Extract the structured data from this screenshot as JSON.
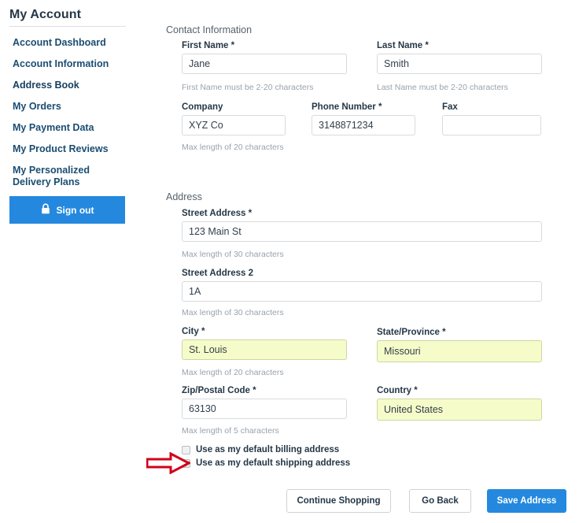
{
  "sidebar": {
    "title": "My Account",
    "items": [
      {
        "label": "Account Dashboard",
        "active": false
      },
      {
        "label": "Account Information",
        "active": false
      },
      {
        "label": "Address Book",
        "active": true
      },
      {
        "label": "My Orders",
        "active": false
      },
      {
        "label": "My Payment Data",
        "active": false
      },
      {
        "label": "My Product Reviews",
        "active": false
      },
      {
        "label": "My Personalized Delivery Plans",
        "active": false
      }
    ],
    "signout_label": "Sign out",
    "signout_icon": "lock-icon",
    "signout_color": "#2489de"
  },
  "contact_section": {
    "heading": "Contact Information",
    "first_name": {
      "label": "First Name",
      "required": "*",
      "value": "Jane",
      "hint": "First Name must be 2-20 characters"
    },
    "last_name": {
      "label": "Last Name",
      "required": "*",
      "value": "Smith",
      "hint": "Last Name must be 2-20 characters"
    },
    "company": {
      "label": "Company",
      "required": "",
      "value": "XYZ Co",
      "hint": "Max length of 20 characters"
    },
    "phone": {
      "label": "Phone Number",
      "required": "*",
      "value": "3148871234",
      "hint": ""
    },
    "fax": {
      "label": "Fax",
      "required": "",
      "value": "",
      "hint": ""
    }
  },
  "address_section": {
    "heading": "Address",
    "street1": {
      "label": "Street Address",
      "required": "*",
      "value": "123 Main St",
      "hint": "Max length of 30 characters"
    },
    "street2": {
      "label": "Street Address 2",
      "required": "",
      "value": "1A",
      "hint": "Max length of 30 characters"
    },
    "city": {
      "label": "City",
      "required": "*",
      "value": "St. Louis",
      "hint": "Max length of 20 characters",
      "autofilled": true
    },
    "state": {
      "label": "State/Province",
      "required": "*",
      "value": "Missouri",
      "hint": "",
      "autofilled": true
    },
    "zip": {
      "label": "Zip/Postal Code",
      "required": "*",
      "value": "63130",
      "hint": "Max length of 5 characters"
    },
    "country": {
      "label": "Country",
      "required": "*",
      "value": "United States",
      "hint": "",
      "autofilled": true
    }
  },
  "checkboxes": {
    "billing": {
      "label": "Use as my default billing address",
      "checked": false
    },
    "shipping": {
      "label": "Use as my default shipping address",
      "checked": true
    }
  },
  "annotation": {
    "type": "right-arrow",
    "color": "#d0021b",
    "points_to": "default-shipping-address-checkbox"
  },
  "actions": {
    "continue_shopping": "Continue Shopping",
    "go_back": "Go Back",
    "save_address": "Save Address",
    "primary_color": "#2489de"
  },
  "autofill_color": "#f6fcc9"
}
